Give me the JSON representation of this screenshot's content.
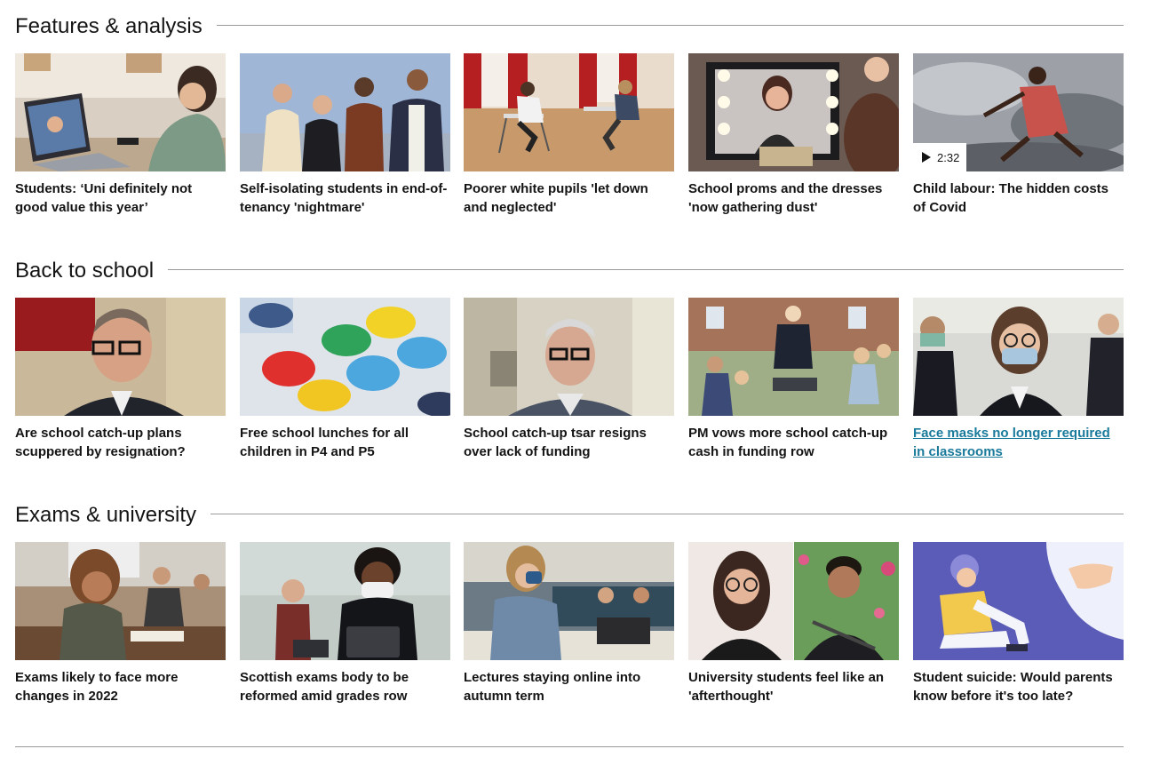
{
  "sections": [
    {
      "title": "Features & analysis",
      "cards": [
        {
          "headline": "Students: ‘Uni definitely not good value this year’",
          "image": "student-laptop-video-call"
        },
        {
          "headline": "Self-isolating students in end-of-tenancy 'nightmare'",
          "image": "four-students-group"
        },
        {
          "headline": "Poorer white pupils 'let down and neglected'",
          "image": "pupils-exam-hall"
        },
        {
          "headline": "School proms and the dresses 'now gathering dust'",
          "image": "girl-makeup-mirror"
        },
        {
          "headline": "Child labour: The hidden costs of Covid",
          "image": "child-stormy-sky",
          "video_duration": "2:32"
        }
      ]
    },
    {
      "title": "Back to school",
      "cards": [
        {
          "headline": "Are school catch-up plans scuppered by resignation?",
          "image": "man-glasses-speaking"
        },
        {
          "headline": "Free school lunches for all children in P4 and P5",
          "image": "colourful-lunch-trays"
        },
        {
          "headline": "School catch-up tsar resigns over lack of funding",
          "image": "man-video-call"
        },
        {
          "headline": "PM vows more school catch-up cash in funding row",
          "image": "pm-with-children"
        },
        {
          "headline": "Face masks no longer required in classrooms",
          "image": "pupil-face-mask",
          "hovered": true
        }
      ]
    },
    {
      "title": "Exams & university",
      "cards": [
        {
          "headline": "Exams likely to face more changes in 2022",
          "image": "students-sitting-exam"
        },
        {
          "headline": "Scottish exams body to be reformed amid grades row",
          "image": "pupil-mask-tablet"
        },
        {
          "headline": "Lectures staying online into autumn term",
          "image": "student-mask-lecture"
        },
        {
          "headline": "University students feel like an 'afterthought'",
          "image": "two-student-portraits"
        },
        {
          "headline": "Student suicide: Would parents know before it's too late?",
          "image": "illustration-sad-student"
        }
      ]
    }
  ],
  "colors": {
    "link_hover": "#1a7a9c",
    "rule": "#9a9a9a",
    "text": "#141414"
  }
}
